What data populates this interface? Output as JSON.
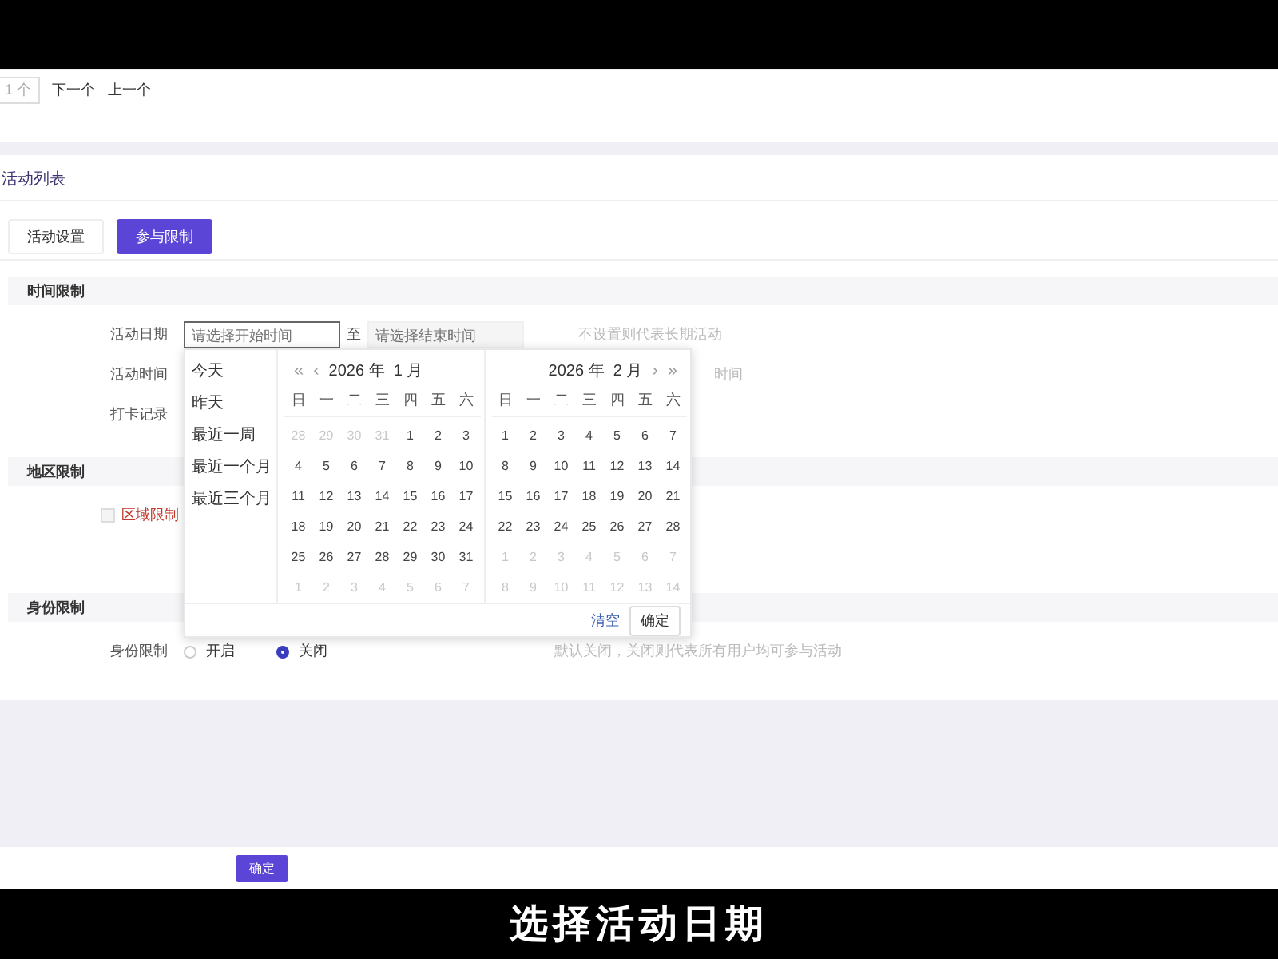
{
  "toolbar": {
    "page_count": "1 个",
    "links": [
      "下一个",
      "上一个"
    ]
  },
  "card": {
    "title": "活动列表",
    "tabs": [
      {
        "label": "活动设置",
        "selected": false
      },
      {
        "label": "参与限制",
        "selected": true
      }
    ],
    "sections": [
      {
        "title": "时间限制",
        "rows": [
          {
            "kind": "daterange",
            "label": "活动日期",
            "start_placeholder": "请选择开始时间",
            "separator": "至",
            "end_placeholder": "请选择结束时间",
            "focused": true,
            "hint": "不设置则代表长期活动"
          },
          {
            "kind": "plain",
            "label": "活动时间",
            "hint": "时间"
          },
          {
            "kind": "plain",
            "label": "打卡记录"
          }
        ]
      },
      {
        "title": "地区限制",
        "rows": [
          {
            "kind": "checkbox",
            "text": "区域限制",
            "checked": false
          }
        ]
      },
      {
        "title": "身份限制",
        "rows": [
          {
            "kind": "radio",
            "label": "身份限制",
            "options": [
              {
                "label": "开启",
                "selected": false
              },
              {
                "label": "关闭",
                "selected": true
              }
            ],
            "hint": "默认关闭，关闭则代表所有用户均可参与活动"
          }
        ]
      }
    ]
  },
  "date_picker": {
    "shortcuts": [
      "今天",
      "昨天",
      "最近一周",
      "最近一个月",
      "最近三个月"
    ],
    "months": [
      {
        "title": "2026 年  1 月",
        "kind": "start",
        "nav": [
          "«",
          "‹"
        ],
        "weekdays": [
          "日",
          "一",
          "二",
          "三",
          "四",
          "五",
          "六"
        ],
        "prev_days": [
          "28",
          "29",
          "30",
          "31"
        ],
        "days": [
          "1",
          "2",
          "3",
          "4",
          "5",
          "6",
          "7",
          "8",
          "9",
          "10",
          "11",
          "12",
          "13",
          "14",
          "15",
          "16",
          "17",
          "18",
          "19",
          "20",
          "21",
          "22",
          "23",
          "24",
          "25",
          "26",
          "27",
          "28",
          "29",
          "30",
          "31"
        ],
        "next_days": [
          "1",
          "2",
          "3",
          "4",
          "5",
          "6",
          "7"
        ]
      },
      {
        "title": "2026 年  2 月",
        "kind": "end",
        "nav": [
          "›",
          "»"
        ],
        "weekdays": [
          "日",
          "一",
          "二",
          "三",
          "四",
          "五",
          "六"
        ],
        "days": [
          "1",
          "2",
          "3",
          "4",
          "5",
          "6",
          "7",
          "8",
          "9",
          "10",
          "11",
          "12",
          "13",
          "14",
          "15",
          "16",
          "17",
          "18",
          "19",
          "20",
          "21",
          "22",
          "23",
          "24",
          "25",
          "26",
          "27",
          "28"
        ],
        "next_days": [
          "1",
          "2",
          "3",
          "4",
          "5",
          "6",
          "7",
          "8",
          "9",
          "10",
          "11",
          "12",
          "13",
          "14"
        ]
      }
    ],
    "buttons": [
      "清空",
      "确定"
    ]
  },
  "footer": {
    "button": "确定"
  },
  "subtitle": "选择活动日期"
}
